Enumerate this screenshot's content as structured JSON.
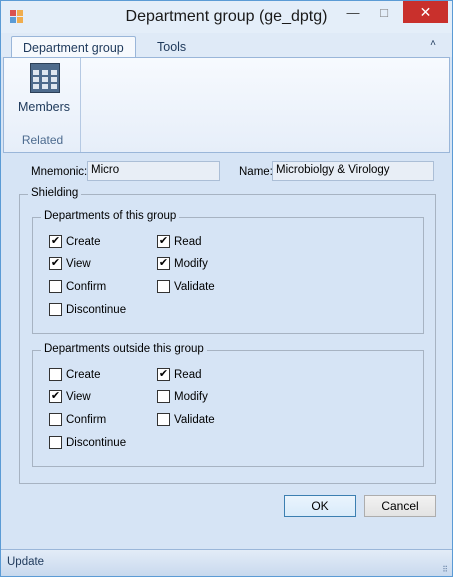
{
  "window": {
    "title": "Department group (ge_dptg)",
    "minimize_icon": "—",
    "maximize_icon": "□",
    "close_icon": "✕"
  },
  "ribbon": {
    "tabs": [
      {
        "label": "Department group",
        "active": true
      },
      {
        "label": "Tools",
        "active": false
      }
    ],
    "collapse_icon": "˄",
    "groups": [
      {
        "label": "Related",
        "buttons": [
          {
            "label": "Members",
            "icon": "members-grid-icon"
          }
        ]
      }
    ]
  },
  "form": {
    "mnemonic_label": "Mnemonic:",
    "mnemonic_value": "Micro",
    "name_label": "Name:",
    "name_value": "Microbiolgy & Virology"
  },
  "shielding": {
    "legend": "Shielding",
    "inside": {
      "legend": "Departments of this group",
      "create": {
        "label": "Create",
        "checked": true
      },
      "read": {
        "label": "Read",
        "checked": true
      },
      "view": {
        "label": "View",
        "checked": true
      },
      "modify": {
        "label": "Modify",
        "checked": true
      },
      "confirm": {
        "label": "Confirm",
        "checked": false
      },
      "validate": {
        "label": "Validate",
        "checked": false
      },
      "discontinue": {
        "label": "Discontinue",
        "checked": false
      }
    },
    "outside": {
      "legend": "Departments outside this group",
      "create": {
        "label": "Create",
        "checked": false
      },
      "read": {
        "label": "Read",
        "checked": true
      },
      "view": {
        "label": "View",
        "checked": true
      },
      "modify": {
        "label": "Modify",
        "checked": false
      },
      "confirm": {
        "label": "Confirm",
        "checked": false
      },
      "validate": {
        "label": "Validate",
        "checked": false
      },
      "discontinue": {
        "label": "Discontinue",
        "checked": false
      }
    }
  },
  "buttons": {
    "ok": "OK",
    "cancel": "Cancel"
  },
  "status": {
    "text": "Update"
  }
}
